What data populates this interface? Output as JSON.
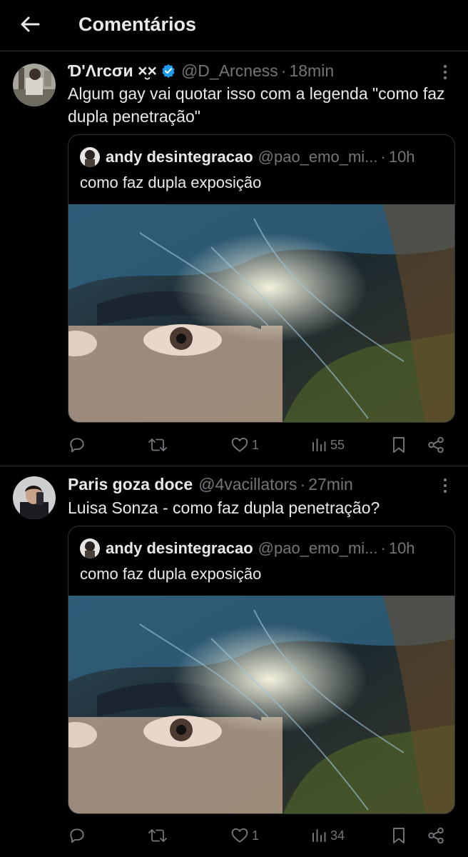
{
  "header": {
    "title": "Comentários"
  },
  "tweets": [
    {
      "display_name": "Ɗ'Λrcσи ×̮×",
      "handle": "@D_Arcness",
      "time": "18min",
      "verified": true,
      "text": "Algum gay vai quotar isso com a legenda \"como faz dupla penetração\"",
      "quote": {
        "display_name": "andy desintegracao",
        "handle": "@pao_emo_mi...",
        "time": "10h",
        "text": "como faz dupla exposição"
      },
      "stats": {
        "replies": "",
        "retweets": "",
        "likes": "1",
        "views": "55"
      }
    },
    {
      "display_name": "Paris goza doce",
      "handle": "@4vacillators",
      "time": "27min",
      "verified": false,
      "text": "Luisa Sonza - como faz dupla penetração?",
      "quote": {
        "display_name": "andy desintegracao",
        "handle": "@pao_emo_mi...",
        "time": "10h",
        "text": "como faz dupla exposição"
      },
      "stats": {
        "replies": "",
        "retweets": "",
        "likes": "1",
        "views": "34"
      }
    }
  ],
  "colors": {
    "background": "#000000",
    "text": "#e7e9ea",
    "muted": "#71767b",
    "divider": "#2f3336",
    "verified": "#1d9bf0"
  }
}
